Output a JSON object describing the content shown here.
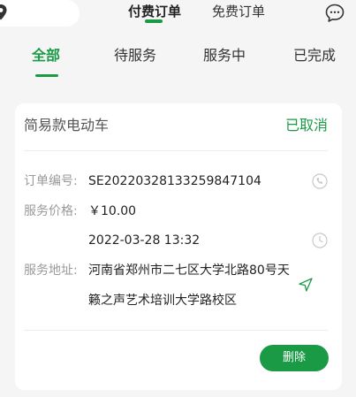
{
  "order_type_tabs": [
    {
      "label": "付费订单",
      "active": true
    },
    {
      "label": "免费订单",
      "active": false
    }
  ],
  "status_tabs": [
    {
      "label": "全部",
      "active": true
    },
    {
      "label": "待服务",
      "active": false
    },
    {
      "label": "服务中",
      "active": false
    },
    {
      "label": "已完成",
      "active": false
    }
  ],
  "order": {
    "title": "简易款电动车",
    "status": "已取消",
    "order_no_label": "订单编号:",
    "order_no": "SE20220328133259847104",
    "price_label": "服务价格:",
    "price": "￥10.00",
    "datetime": "2022-03-28 13:32",
    "address_label": "服务地址:",
    "address_line1": "河南省郑州市二七区大学北路80号天",
    "address_line2": "籁之声艺术培训大学路校区",
    "delete_label": "删除"
  },
  "icons": {
    "location": "location-pin-icon",
    "message": "chat-bubble-icon",
    "phone": "phone-icon",
    "clock": "clock-icon",
    "navigate": "navigation-arrow-icon"
  },
  "colors": {
    "accent": "#1a9a45",
    "background": "#f5f5f5",
    "card": "#ffffff",
    "muted_text": "#999999"
  }
}
